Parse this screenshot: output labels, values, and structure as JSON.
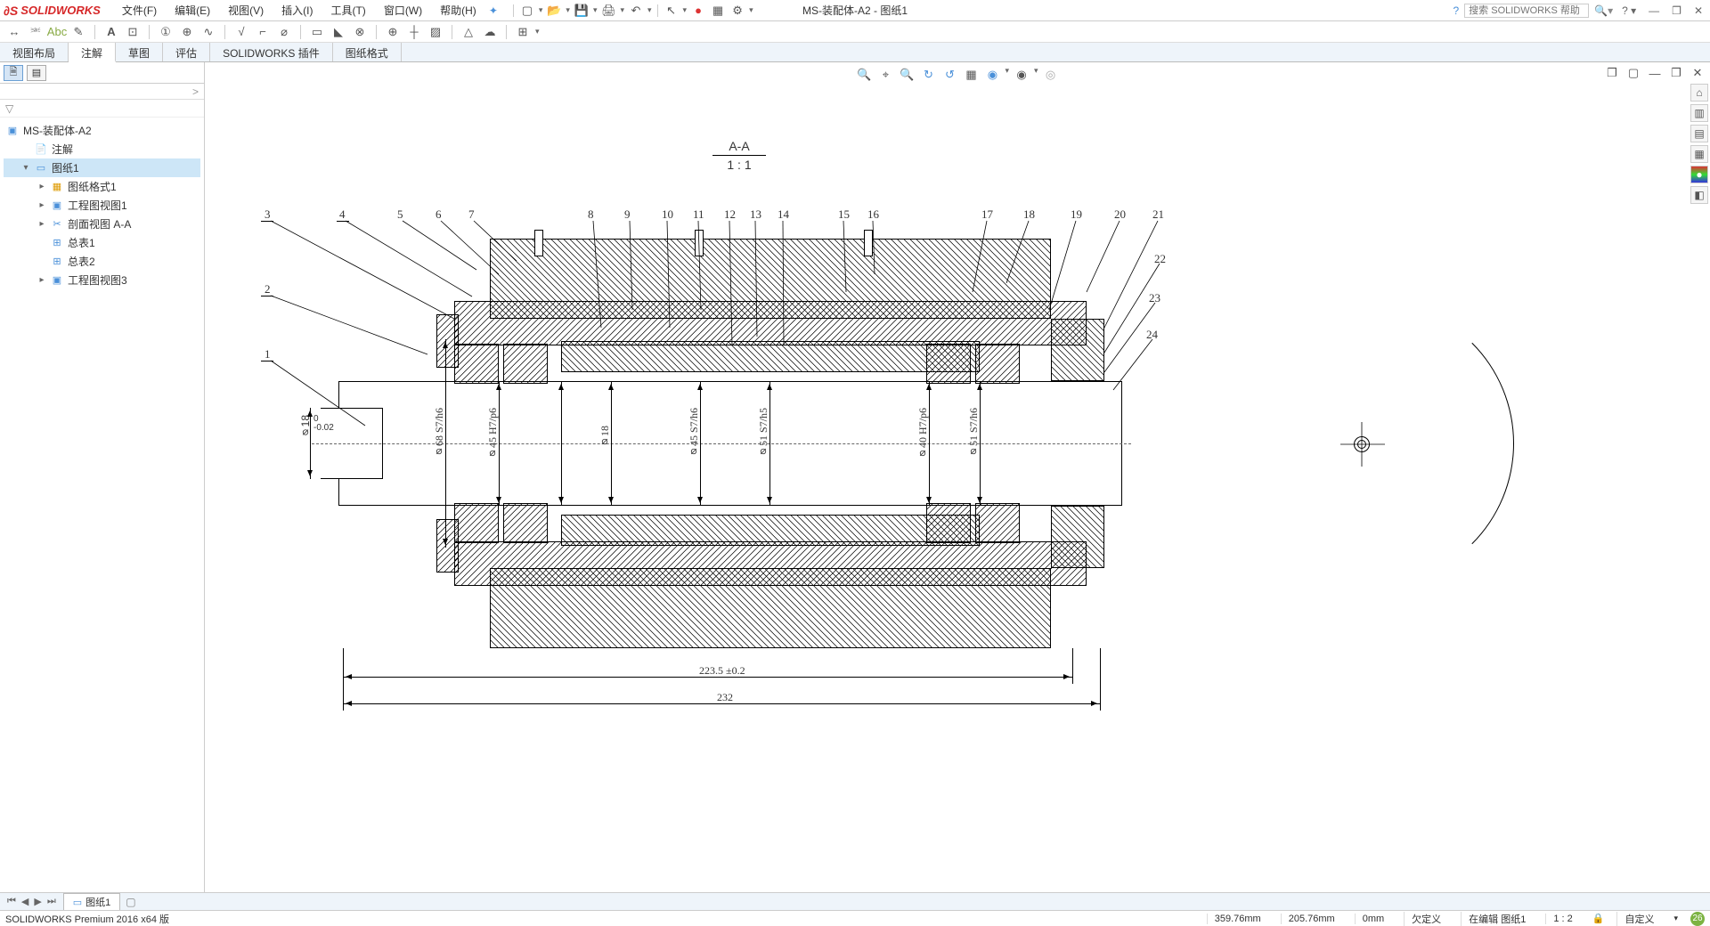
{
  "app": {
    "logo_text": "SOLIDWORKS",
    "title": "MS-装配体-A2 - 图纸1"
  },
  "menu": [
    "文件(F)",
    "编辑(E)",
    "视图(V)",
    "插入(I)",
    "工具(T)",
    "窗口(W)",
    "帮助(H)"
  ],
  "search": {
    "placeholder": "搜索 SOLIDWORKS 帮助"
  },
  "tabs": [
    "视图布局",
    "注解",
    "草图",
    "评估",
    "SOLIDWORKS 插件",
    "图纸格式"
  ],
  "active_tab": "注解",
  "tree": {
    "root": "MS-装配体-A2",
    "items": [
      {
        "icon": "note-icon",
        "label": "注解",
        "indent": 1,
        "exp": ""
      },
      {
        "icon": "sheet-icon",
        "label": "图纸1",
        "indent": 1,
        "exp": "▾",
        "selected": true
      },
      {
        "icon": "format-icon",
        "label": "图纸格式1",
        "indent": 2,
        "exp": "▸"
      },
      {
        "icon": "view-icon",
        "label": "工程图视图1",
        "indent": 2,
        "exp": "▸"
      },
      {
        "icon": "section-icon",
        "label": "剖面视图 A-A",
        "indent": 2,
        "exp": "▸"
      },
      {
        "icon": "table-icon",
        "label": "总表1",
        "indent": 2,
        "exp": ""
      },
      {
        "icon": "table-icon",
        "label": "总表2",
        "indent": 2,
        "exp": ""
      },
      {
        "icon": "view-icon",
        "label": "工程图视图3",
        "indent": 2,
        "exp": "▸"
      }
    ]
  },
  "section": {
    "label": "A-A",
    "scale": "1 : 1"
  },
  "balloons": [
    "1",
    "2",
    "3",
    "4",
    "5",
    "6",
    "7",
    "8",
    "9",
    "10",
    "11",
    "12",
    "13",
    "14",
    "15",
    "16",
    "17",
    "18",
    "19",
    "20",
    "21",
    "22",
    "23",
    "24"
  ],
  "dims": {
    "d18_left": "⌀18 ",
    "d18_tol_up": "0",
    "d18_tol_dn": "-0.02",
    "d68": "⌀68 S7/h6",
    "d45a": "⌀45 H7/p6",
    "d18": "⌀18",
    "d45b": "⌀45 S7/h6",
    "d51a": "⌀51 S7/h5",
    "d40": "⌀40 H7/p6",
    "d51b": "⌀51 S7/h6",
    "len1": "223.5 ±0.2",
    "len2": "232"
  },
  "sheet_tab": "图纸1",
  "status": {
    "left": "SOLIDWORKS Premium 2016 x64 版",
    "x": "359.76mm",
    "y": "205.76mm",
    "z": "0mm",
    "under": "欠定义",
    "edit": "在编辑 图纸1",
    "scale": "1 : 2",
    "custom": "自定义",
    "badge": "26"
  }
}
